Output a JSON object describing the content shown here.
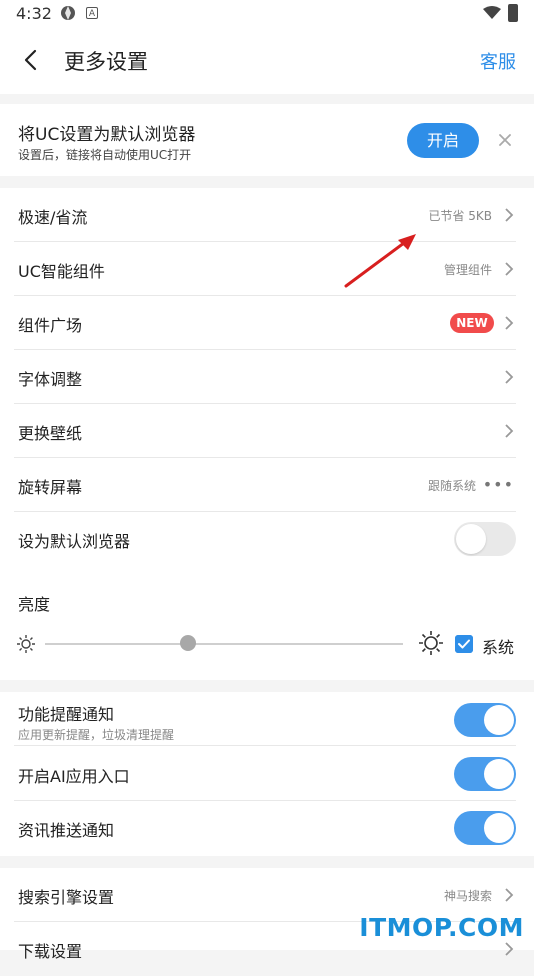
{
  "status_bar": {
    "time": "4:32",
    "icon_a": "A"
  },
  "header": {
    "title": "更多设置",
    "service": "客服"
  },
  "banner": {
    "title": "将UC设置为默认浏览器",
    "subtitle": "设置后，链接将自动使用UC打开",
    "button": "开启"
  },
  "settings": {
    "speed": {
      "label": "极速/省流",
      "value": "已节省 5KB"
    },
    "widget": {
      "label": "UC智能组件",
      "value": "管理组件"
    },
    "plaza": {
      "label": "组件广场",
      "badge": "NEW"
    },
    "font": {
      "label": "字体调整"
    },
    "wallpaper": {
      "label": "更换壁纸"
    },
    "rotate": {
      "label": "旋转屏幕",
      "value": "跟随系统"
    },
    "default_browser": {
      "label": "设为默认浏览器",
      "enabled": false
    }
  },
  "brightness": {
    "label": "亮度",
    "level": 0.4,
    "system_label": "系统",
    "system_checked": true
  },
  "notifications": {
    "feature": {
      "label": "功能提醒通知",
      "sub": "应用更新提醒，垃圾清理提醒",
      "enabled": true
    },
    "ai": {
      "label": "开启AI应用入口",
      "enabled": true
    },
    "news": {
      "label": "资讯推送通知",
      "enabled": true
    }
  },
  "search": {
    "engine": {
      "label": "搜索引擎设置",
      "value": "神马搜索"
    },
    "download": {
      "label": "下载设置"
    }
  },
  "colors": {
    "accent": "#2e8ee8",
    "toggle_on": "#4a9ded",
    "badge": "#f14b4b"
  },
  "watermark": "ITMOP.COM"
}
